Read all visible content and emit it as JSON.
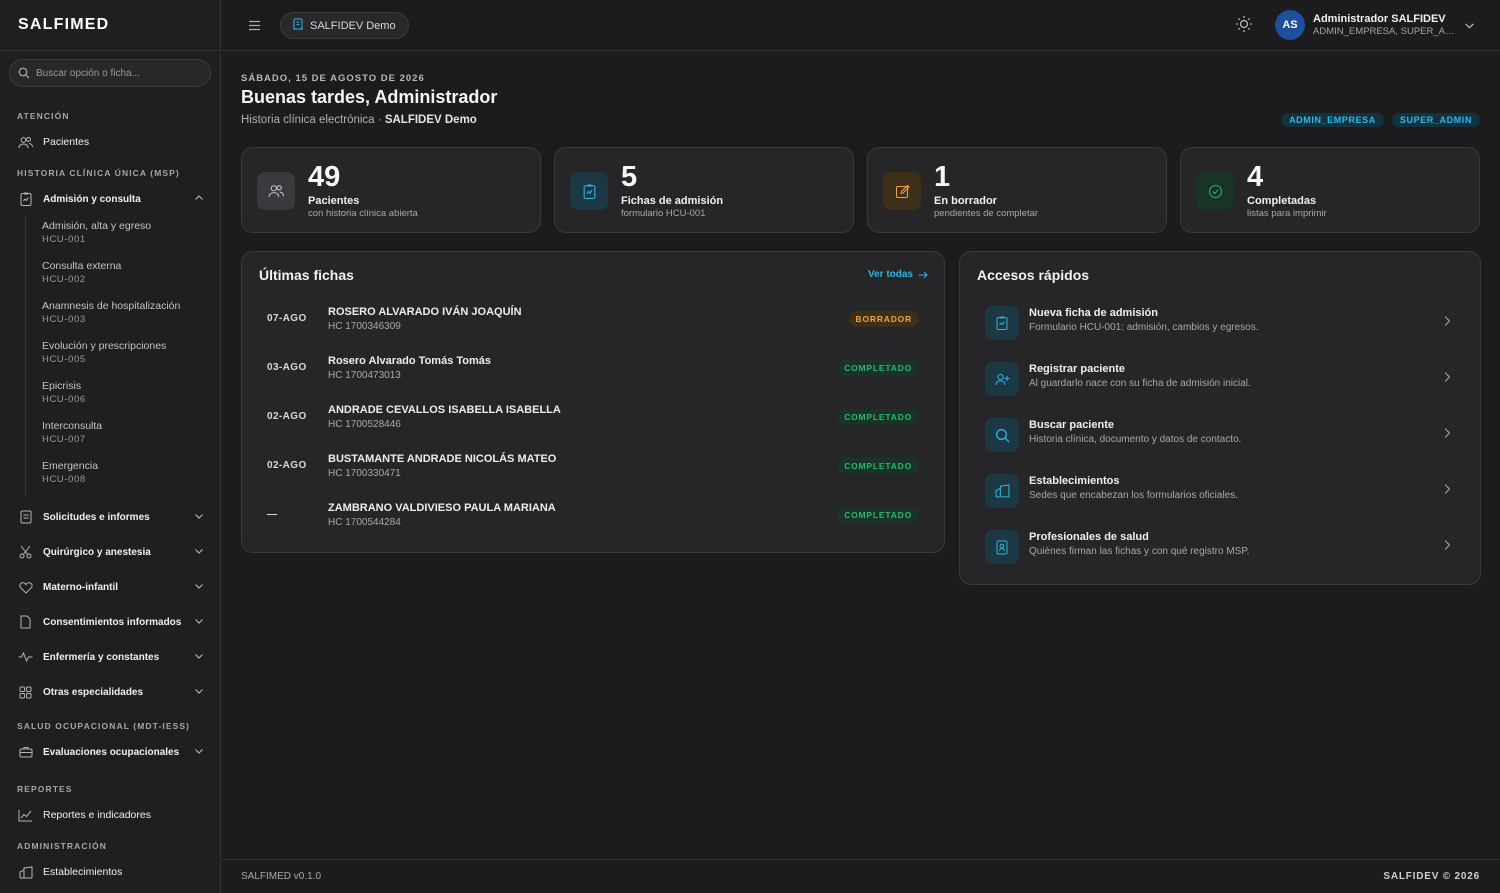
{
  "sidebar": {
    "brand": "SALFIMED",
    "search_placeholder": "Buscar opción o ficha...",
    "sections": {
      "atencion": "ATENCIÓN",
      "hcu": "HISTORIA CLÍNICA ÚNICA (MSP)",
      "salud_ocupacional": "SALUD OCUPACIONAL (MDT-IESS)",
      "reportes": "REPORTES",
      "administracion": "ADMINISTRACIÓN"
    },
    "pacientes": "Pacientes",
    "admision_group": "Admisión y consulta",
    "sub_items": [
      {
        "title": "Admisión, alta y egreso",
        "code": "HCU-001"
      },
      {
        "title": "Consulta externa",
        "code": "HCU-002"
      },
      {
        "title": "Anamnesis de hospitalización",
        "code": "HCU-003"
      },
      {
        "title": "Evolución y prescripciones",
        "code": "HCU-005"
      },
      {
        "title": "Epicrisis",
        "code": "HCU-006"
      },
      {
        "title": "Interconsulta",
        "code": "HCU-007"
      },
      {
        "title": "Emergencia",
        "code": "HCU-008"
      }
    ],
    "groups": [
      "Solicitudes e informes",
      "Quirúrgico y anestesia",
      "Materno-infantil",
      "Consentimientos informados",
      "Enfermería y constantes",
      "Otras especialidades"
    ],
    "evaluaciones": "Evaluaciones ocupacionales",
    "reportes_item": "Reportes e indicadores",
    "establecimientos_item": "Establecimientos"
  },
  "header": {
    "tenant": "SALFIDEV Demo",
    "avatar_initials": "AS",
    "user_name": "Administrador SALFIDEV",
    "user_roles": "ADMIN_EMPRESA, SUPER_ADMIN"
  },
  "main": {
    "date": "SÁBADO, 15 DE AGOSTO DE 2026",
    "greeting": "Buenas tardes, Administrador",
    "subtitle_prefix": "Historia clínica electrónica · ",
    "subtitle_org": "SALFIDEV Demo",
    "badges": [
      "ADMIN_EMPRESA",
      "SUPER_ADMIN"
    ],
    "stats": [
      {
        "value": "49",
        "label": "Pacientes",
        "sub": "con historia clínica abierta",
        "icon": "users-icon",
        "color": "#3a3a3e"
      },
      {
        "value": "5",
        "label": "Fichas de admisión",
        "sub": "formulario HCU-001",
        "icon": "clipboard-icon",
        "color": "#1b3844"
      },
      {
        "value": "1",
        "label": "En borrador",
        "sub": "pendientes de completar",
        "icon": "edit-icon",
        "color": "#3d2f18"
      },
      {
        "value": "4",
        "label": "Completadas",
        "sub": "listas para imprimir",
        "icon": "check-circle-icon",
        "color": "#193326"
      }
    ],
    "fichas": {
      "title": "Últimas fichas",
      "ver_todas": "Ver todas",
      "rows": [
        {
          "date": "07-AGO",
          "name": "ROSERO ALVARADO IVÁN JOAQUÍN",
          "hc": "HC 1700346309",
          "status": "BORRADOR",
          "kind": "borr"
        },
        {
          "date": "03-AGO",
          "name": "Rosero Alvarado Tomás Tomás",
          "hc": "HC 1700473013",
          "status": "COMPLETADO",
          "kind": "comp"
        },
        {
          "date": "02-AGO",
          "name": "ANDRADE CEVALLOS ISABELLA ISABELLA",
          "hc": "HC 1700528446",
          "status": "COMPLETADO",
          "kind": "comp"
        },
        {
          "date": "02-AGO",
          "name": "BUSTAMANTE ANDRADE NICOLÁS MATEO",
          "hc": "HC 1700330471",
          "status": "COMPLETADO",
          "kind": "comp"
        },
        {
          "date": "—",
          "name": "ZAMBRANO VALDIVIESO PAULA MARIANA",
          "hc": "HC 1700544284",
          "status": "COMPLETADO",
          "kind": "comp"
        }
      ]
    },
    "accesos": {
      "title": "Accesos rápidos",
      "items": [
        {
          "title": "Nueva ficha de admisión",
          "sub": "Formulario HCU-001: admisión, cambios y egresos.",
          "icon": "clipboard-icon"
        },
        {
          "title": "Registrar paciente",
          "sub": "Al guardarlo nace con su ficha de admisión inicial.",
          "icon": "user-plus-icon"
        },
        {
          "title": "Buscar paciente",
          "sub": "Historia clínica, documento y datos de contacto.",
          "icon": "search-icon"
        },
        {
          "title": "Establecimientos",
          "sub": "Sedes que encabezan los formularios oficiales.",
          "icon": "building-icon"
        },
        {
          "title": "Profesionales de salud",
          "sub": "Quiénes firman las fichas y con qué registro MSP.",
          "icon": "id-badge-icon"
        }
      ]
    }
  },
  "footer": {
    "version": "SALFIMED v0.1.0",
    "copyright": "SALFIDEV © 2026"
  }
}
